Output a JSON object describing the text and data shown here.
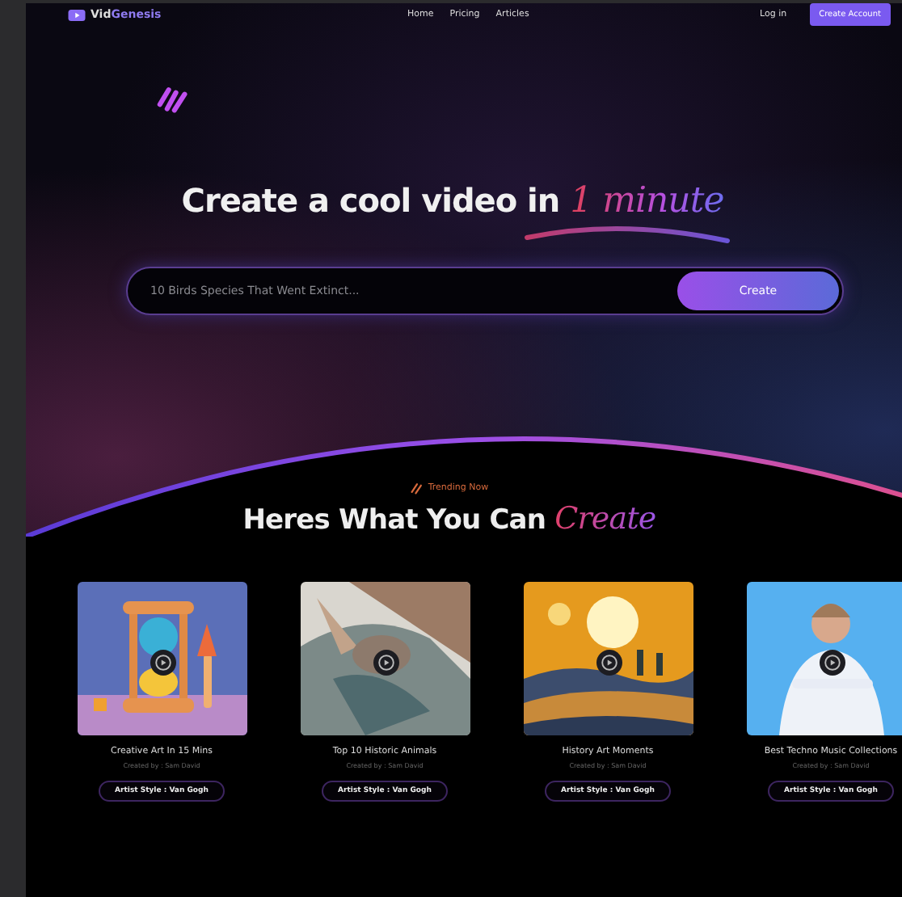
{
  "nav": {
    "logo_prefix": "Vid",
    "logo_suffix": "Genesis",
    "links": [
      "Home",
      "Pricing",
      "Articles"
    ],
    "login": "Log in",
    "cta": "Create Account"
  },
  "hero": {
    "title": "Create a cool video in",
    "highlight": "1 minute",
    "search": {
      "placeholder": "10 Birds Species That Went Extinct..."
    },
    "button": "Create"
  },
  "trending": {
    "eyebrow": "Trending Now",
    "title": "Heres What You Can",
    "highlight": "Create"
  },
  "cards": [
    {
      "title": "Creative Art In 15 Mins",
      "creator": "Created by : Sam David",
      "tag": "Artist Style : Van Gogh"
    },
    {
      "title": "Top 10 Historic Animals",
      "creator": "Created by : Sam David",
      "tag": "Artist Style : Van Gogh"
    },
    {
      "title": "History Art Moments",
      "creator": "Created by : Sam David",
      "tag": "Artist Style : Van Gogh"
    },
    {
      "title": "Best Techno Music Collections",
      "creator": "Created by : Sam David",
      "tag": "Artist Style : Van Gogh"
    }
  ]
}
